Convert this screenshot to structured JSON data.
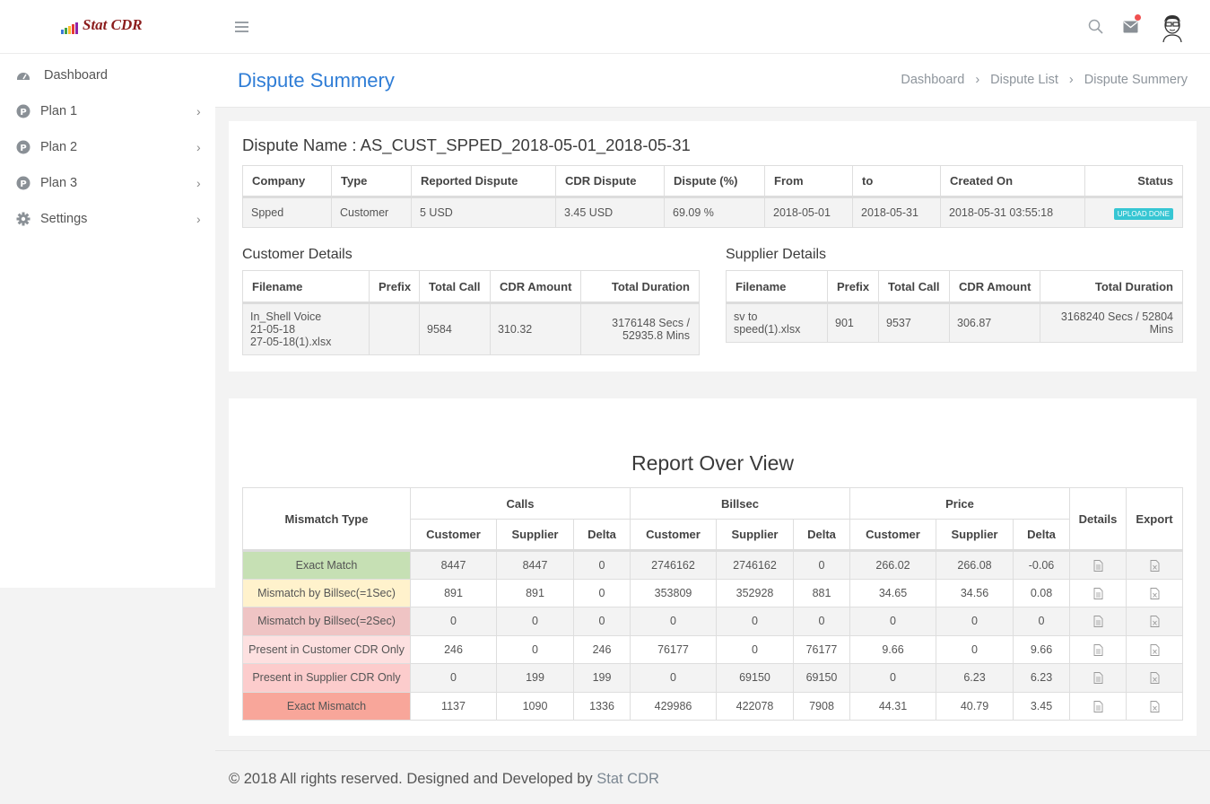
{
  "app": {
    "logo_text": "Stat CDR",
    "logo_bar_colors": [
      "#3c78d8",
      "#43a047",
      "#fbc02d",
      "#e53935",
      "#8e24aa"
    ]
  },
  "topbar": {
    "icons": [
      "menu-icon",
      "search-icon",
      "mail-icon",
      "avatar"
    ]
  },
  "sidebar": {
    "items": [
      {
        "label": "Dashboard",
        "icon": "dashboard-icon",
        "has_chevron": false
      },
      {
        "label": "Plan 1",
        "icon": "plan-icon",
        "has_chevron": true
      },
      {
        "label": "Plan 2",
        "icon": "plan-icon",
        "has_chevron": true
      },
      {
        "label": "Plan 3",
        "icon": "plan-icon",
        "has_chevron": true
      },
      {
        "label": "Settings",
        "icon": "gear-icon",
        "has_chevron": true
      }
    ]
  },
  "page": {
    "title": "Dispute Summery",
    "breadcrumb": [
      "Dashboard",
      "Dispute List",
      "Dispute Summery"
    ]
  },
  "dispute": {
    "name_line": "Dispute Name : AS_CUST_SPPED_2018-05-01_2018-05-31",
    "headers": [
      "Company",
      "Type",
      "Reported Dispute",
      "CDR Dispute",
      "Dispute (%)",
      "From",
      "to",
      "Created On",
      "Status"
    ],
    "row": [
      "Spped",
      "Customer",
      "5 USD",
      "3.45 USD",
      "69.09 %",
      "2018-05-01",
      "2018-05-31",
      "2018-05-31 03:55:18"
    ],
    "status": "UPLOAD DONE",
    "status_color": "#36c6d3"
  },
  "customer_details": {
    "title": "Customer Details",
    "headers": [
      "Filename",
      "Prefix",
      "Total Call",
      "CDR Amount",
      "Total Duration"
    ],
    "row": {
      "filename_lines": [
        "In_Shell Voice",
        "21-05-18",
        "27-05-18(1).xlsx"
      ],
      "prefix": "",
      "total_call": "9584",
      "cdr_amount": "310.32",
      "duration_lines": [
        "3176148 Secs /",
        "52935.8 Mins"
      ]
    }
  },
  "supplier_details": {
    "title": "Supplier Details",
    "headers": [
      "Filename",
      "Prefix",
      "Total Call",
      "CDR Amount",
      "Total Duration"
    ],
    "row": {
      "filename_lines": [
        "sv to",
        "speed(1).xlsx"
      ],
      "prefix": "901",
      "total_call": "9537",
      "cdr_amount": "306.87",
      "duration_lines": [
        "3168240 Secs / 52804",
        "Mins"
      ]
    }
  },
  "report": {
    "title": "Report Over View",
    "header_groups": {
      "mismatch_type": "Mismatch Type",
      "calls": "Calls",
      "billsec": "Billsec",
      "price": "Price",
      "details": "Details",
      "export": "Export"
    },
    "sub_headers": [
      "Customer",
      "Supplier",
      "Delta",
      "Customer",
      "Supplier",
      "Delta",
      "Customer",
      "Supplier",
      "Delta"
    ],
    "rows": [
      {
        "type": "Exact Match",
        "color": "#c6e0b4",
        "values": [
          "8447",
          "8447",
          "0",
          "2746162",
          "2746162",
          "0",
          "266.02",
          "266.08",
          "-0.06"
        ]
      },
      {
        "type": "Mismatch by Billsec(=1Sec)",
        "color": "#fff2cc",
        "values": [
          "891",
          "891",
          "0",
          "353809",
          "352928",
          "881",
          "34.65",
          "34.56",
          "0.08"
        ]
      },
      {
        "type": "Mismatch by Billsec(=2Sec)",
        "color": "#efc4c4",
        "values": [
          "0",
          "0",
          "0",
          "0",
          "0",
          "0",
          "0",
          "0",
          "0"
        ]
      },
      {
        "type": "Present in Customer CDR Only",
        "color": "#fde0e0",
        "values": [
          "246",
          "0",
          "246",
          "76177",
          "0",
          "76177",
          "9.66",
          "0",
          "9.66"
        ]
      },
      {
        "type": "Present in Supplier CDR Only",
        "color": "#fccccc",
        "values": [
          "0",
          "199",
          "199",
          "0",
          "69150",
          "69150",
          "0",
          "6.23",
          "6.23"
        ]
      },
      {
        "type": "Exact Mismatch",
        "color": "#f8a69a",
        "values": [
          "1137",
          "1090",
          "1336",
          "429986",
          "422078",
          "7908",
          "44.31",
          "40.79",
          "3.45"
        ]
      }
    ]
  },
  "footer": {
    "text": "© 2018 All rights reserved. Designed and Developed by ",
    "link": "Stat CDR"
  }
}
